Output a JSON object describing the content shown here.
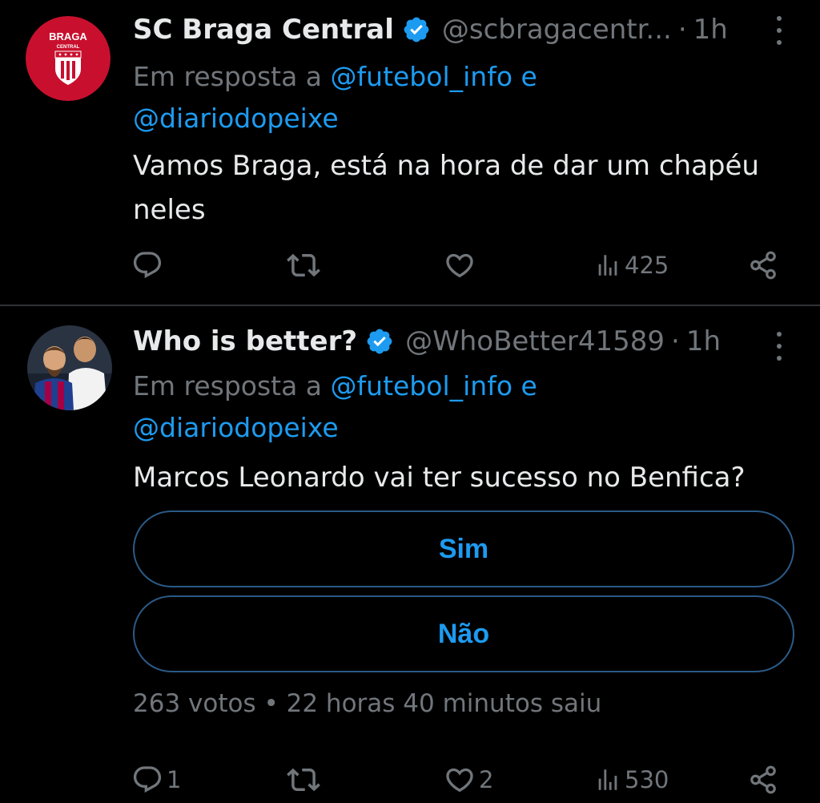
{
  "tweets": [
    {
      "author_name": "SC Braga Central",
      "handle": "@scbragacentr...",
      "separator": "·",
      "time": "1h",
      "reply_prefix": "Em resposta a",
      "reply_mention_1": "@futebol_info",
      "reply_conjunction": "e",
      "reply_mention_2": "@diariodopeixe",
      "text": "Vamos Braga, está na hora de dar um chapéu neles",
      "avatar": {
        "icon": "braga-central-logo",
        "title": "BRAGA",
        "subtitle": "CENTRAL",
        "color": "#c8102e"
      },
      "actions": {
        "replies": "",
        "retweets": "",
        "likes": "",
        "views": "425"
      }
    },
    {
      "author_name": "Who is better?",
      "handle": "@WhoBetter41589",
      "separator": "·",
      "time": "1h",
      "reply_prefix": "Em resposta a",
      "reply_mention_1": "@futebol_info",
      "reply_conjunction": "e",
      "reply_mention_2": "@diariodopeixe",
      "text": "Marcos Leonardo vai ter sucesso no Benfica?",
      "avatar": {
        "icon": "players-photo"
      },
      "poll": {
        "options": [
          "Sim",
          "Não"
        ],
        "votes_label": "263 votos",
        "meta_separator": "•",
        "time_left": "22 horas 40 minutos saiu"
      },
      "actions": {
        "replies": "1",
        "retweets": "",
        "likes": "2",
        "views": "530"
      }
    }
  ],
  "colors": {
    "background": "#000000",
    "text": "#e7e9ea",
    "muted": "#71767b",
    "accent": "#1d9bf0",
    "divider": "#2f3336"
  }
}
